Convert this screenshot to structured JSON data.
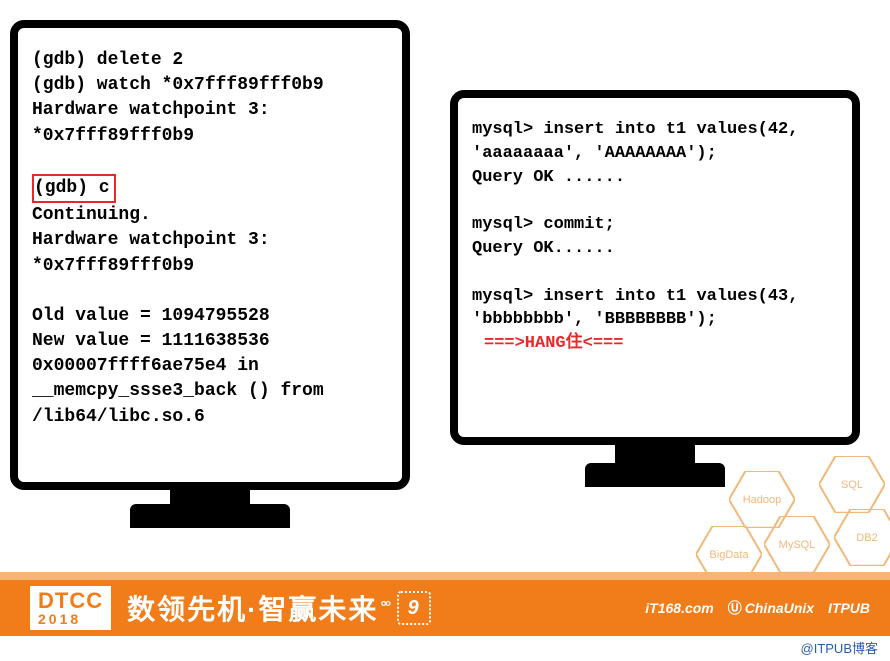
{
  "left_terminal": {
    "line1": "(gdb) delete 2",
    "line2": "(gdb) watch *0x7fff89fff0b9",
    "line3": "Hardware watchpoint 3:",
    "line4": "*0x7fff89fff0b9",
    "line5_boxed": "(gdb) c",
    "line6": "Continuing.",
    "line7": "Hardware watchpoint 3:",
    "line8": "*0x7fff89fff0b9",
    "line9": "Old value = 1094795528",
    "line10": "New value = 1111638536",
    "line11": "0x00007ffff6ae75e4 in",
    "line12": "__memcpy_ssse3_back () from",
    "line13": "/lib64/libc.so.6"
  },
  "right_terminal": {
    "line1a": "mysql>",
    "line1b": " insert into t1 values(42,",
    "line2": "'aaaaaaaa', 'AAAAAAAA');",
    "line3": "Query OK ......",
    "line4a": "mysql>",
    "line4b": " commit;",
    "line5": "Query OK......",
    "line6a": "mysql>",
    "line6b": " insert into t1 values(43,",
    "line7": "'bbbbbbbb', 'BBBBBBBB');",
    "hang": "===>HANG住<==="
  },
  "footer": {
    "badge_top": "DTCC",
    "badge_year": "2018",
    "slogan": "数领先机·智赢未来",
    "nine": "9",
    "sponsors": {
      "s1": "iT168.com",
      "s2": "ChinaUnix",
      "s3": "ITPUB"
    }
  },
  "hexagons": {
    "h1": "SQL",
    "h2": "Hadoop",
    "h3": "MySQL",
    "h4": "DB2",
    "h5": "BigData"
  },
  "watermark": "@ITPUB博客"
}
